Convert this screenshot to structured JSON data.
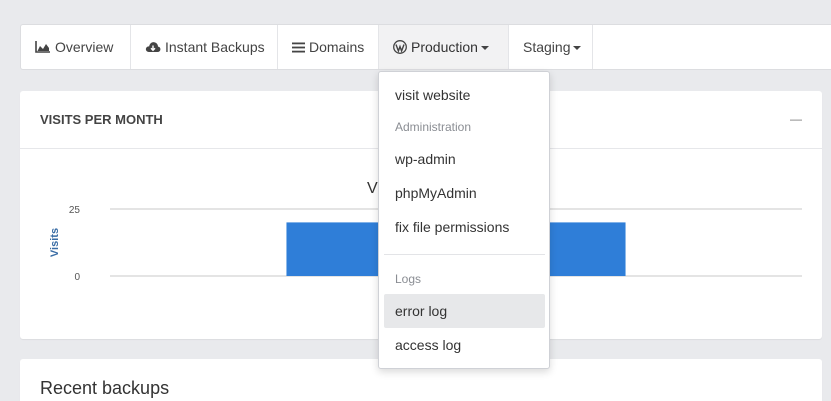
{
  "nav": {
    "items": [
      {
        "label": "Overview",
        "icon": "area-chart-icon"
      },
      {
        "label": "Instant Backups",
        "icon": "cloud-download-icon"
      },
      {
        "label": "Domains",
        "icon": "list-icon"
      },
      {
        "label": "Production",
        "icon": "wordpress-icon",
        "dropdown": true,
        "active": true
      },
      {
        "label": "Staging",
        "dropdown": true
      }
    ]
  },
  "visits_card": {
    "title": "VISITS PER MONTH",
    "minimize_label": "—"
  },
  "chart_data": {
    "type": "bar",
    "title": "Vi",
    "ylabel": "Visits",
    "xlabel": "",
    "ylim": [
      0,
      25
    ],
    "yticks": [
      0,
      25
    ],
    "categories": [
      ""
    ],
    "values": [
      20
    ],
    "bar_color": "#2f7ed8",
    "grid": true
  },
  "backups_card": {
    "title": "Recent backups"
  },
  "dropdown": {
    "visit_website": "visit website",
    "admin_header": "Administration",
    "wp_admin": "wp-admin",
    "phpmyadmin": "phpMyAdmin",
    "fix_permissions": "fix file permissions",
    "logs_header": "Logs",
    "error_log": "error log",
    "access_log": "access log"
  }
}
